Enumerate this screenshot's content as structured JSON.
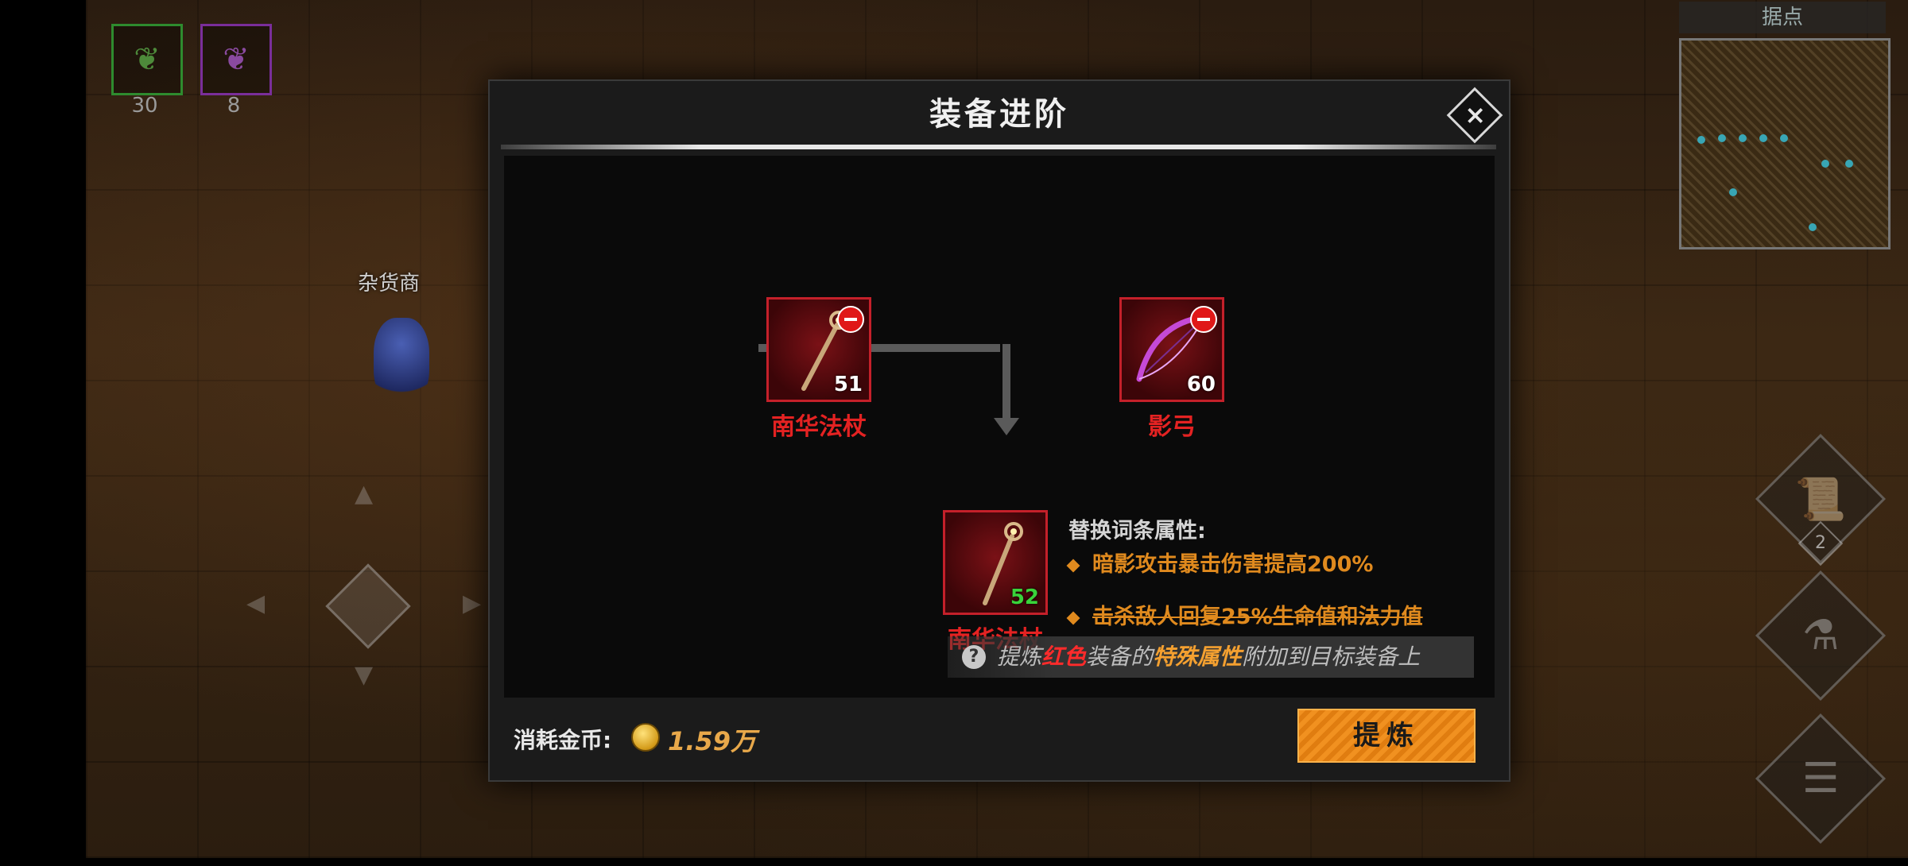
{
  "hud": {
    "resources": [
      {
        "icon": "green-pouch-icon",
        "count": "30",
        "color": "#2e8b2e"
      },
      {
        "icon": "purple-pouch-icon",
        "count": "8",
        "color": "#7a2e9a"
      }
    ],
    "npc_label": "杂货商",
    "minimap_title": "据点",
    "quest_count": "2"
  },
  "dialog": {
    "title": "装备进阶",
    "close_icon": "×",
    "source_items": [
      {
        "name": "南华法杖",
        "level": "51",
        "rarity_color": "#e42222",
        "icon": "staff-icon"
      },
      {
        "name": "影弓",
        "level": "60",
        "rarity_color": "#e42222",
        "icon": "bow-icon"
      }
    ],
    "result_item": {
      "name": "南华法杖",
      "level": "52",
      "icon": "staff-icon"
    },
    "attributes": {
      "title": "替换词条属性:",
      "new": "暗影攻击暴击伤害提高200%",
      "removed": "击杀敌人回复25%生命值和法力值"
    },
    "hint": {
      "q": "?",
      "part1": "提炼",
      "part2": "红色",
      "part3": "装备的",
      "part4": "特殊属性",
      "part5": "附加到目标装备上"
    },
    "cost_label": "消耗金币:",
    "cost_value": "1.59万",
    "refine_button": "提炼"
  },
  "colors": {
    "accent_orange": "#f19120",
    "rarity_red": "#e42222",
    "attribute_orange": "#e08a1e",
    "level_green": "#39d33a"
  }
}
